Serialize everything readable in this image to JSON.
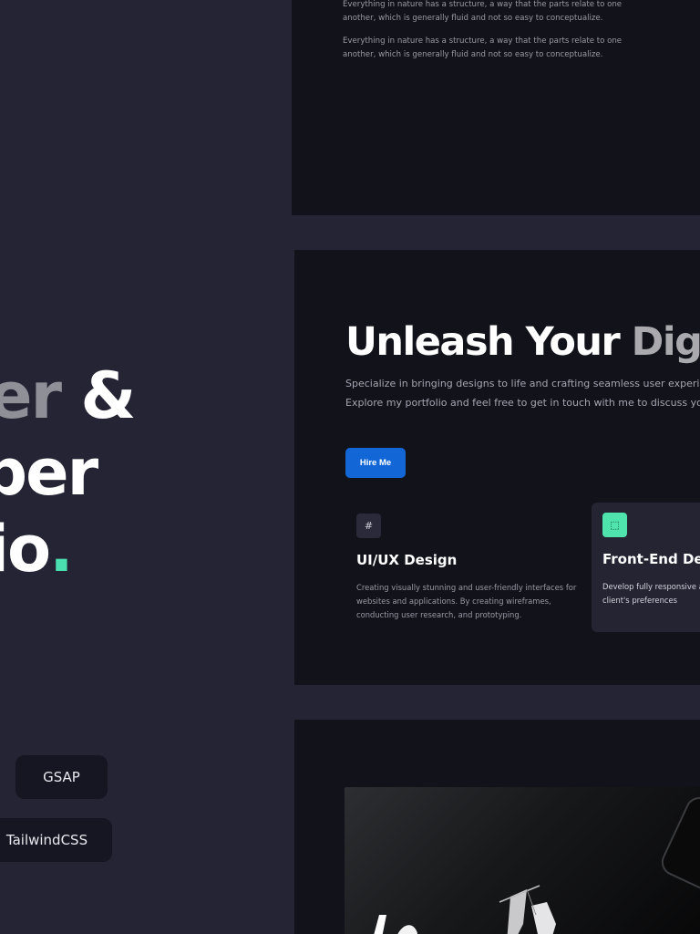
{
  "hero": {
    "line1_part_a": "er",
    "line1_part_b": " &",
    "line2": "per",
    "line3": "io",
    "dot": "."
  },
  "tech_tags": [
    "GSAP",
    "TailwindCSS"
  ],
  "about": {
    "paragraph_1": "Everything in nature has a structure, a way that the parts relate to one another, which is generally fluid and not so easy to conceptualize.",
    "paragraph_2": "Everything in nature has a structure, a way that the parts relate to one another, which is generally fluid and not so easy to conceptualize."
  },
  "services_hero": {
    "headline_a": "Unleash Your ",
    "headline_b": "Digi",
    "subtitle_line1": "Specialize in bringing designs to life and crafting seamless user experien",
    "subtitle_line2": "Explore my portfolio and feel free to get in touch with me to discuss you",
    "cta_label": "Hire Me"
  },
  "services": [
    {
      "icon": "hash-icon",
      "icon_glyph": "#",
      "title": "UI/UX Design",
      "description": "Creating visually stunning and user-friendly interfaces for websites and applications. By creating wireframes, conducting user research, and prototyping."
    },
    {
      "icon": "dashed-square-icon",
      "icon_glyph": "⬚",
      "title": "Front-End Dev",
      "description": "Develop fully responsive a are tailored to the client's preferences"
    }
  ],
  "colors": {
    "background": "#242434",
    "panel": "#12121b",
    "accent_green": "#4be0b0",
    "primary_button": "#1366d6",
    "muted_text": "#8f8f98"
  }
}
